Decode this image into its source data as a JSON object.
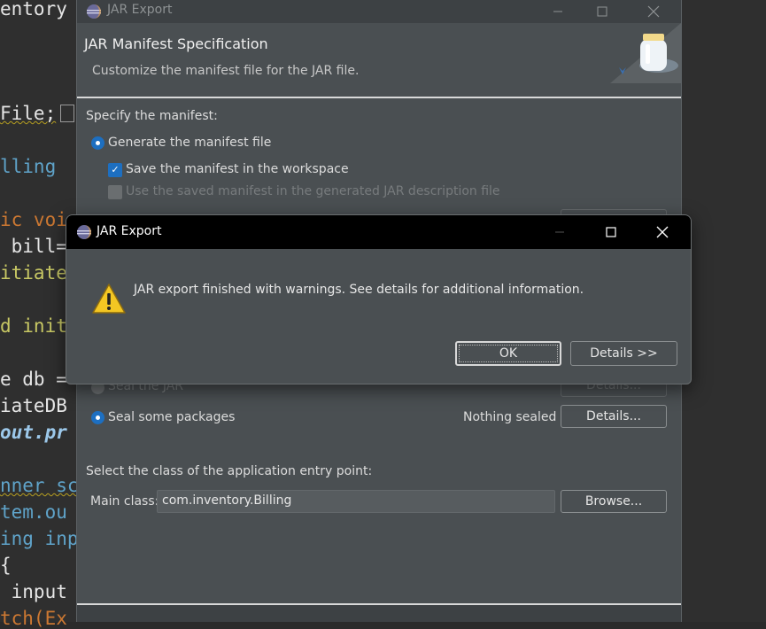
{
  "editor": {
    "lines": [
      {
        "text": "entory",
        "color": "#e6e6e6"
      },
      {
        "text": "File;",
        "color": "#e6e6e6"
      },
      {
        "text": "lling",
        "color": "#5fa3c9"
      },
      {
        "text": "ic voi",
        "color": "#cc7832"
      },
      {
        "text": " bill=",
        "color": "#e6e6e6"
      },
      {
        "text": "itiate",
        "color": "#c8c864"
      },
      {
        "text": "d init",
        "color": "#c8c864"
      },
      {
        "text": "e db =",
        "color": "#e6e6e6"
      },
      {
        "text": "iateDB",
        "color": "#e6e6e6"
      },
      {
        "text": "out.pr",
        "color": "#9cc8ea"
      },
      {
        "text": "nner sc",
        "color": "#5fa3c9"
      },
      {
        "text": "tem.ou",
        "color": "#5fa3c9"
      },
      {
        "text": "ing inp",
        "color": "#5fa3c9"
      },
      {
        "text": "{",
        "color": "#e6e6e6"
      },
      {
        "text": " input",
        "color": "#e6e6e6"
      },
      {
        "text": "tch(Ex",
        "color": "#cc7832"
      }
    ]
  },
  "wizard": {
    "window_title": "JAR Export",
    "header_title": "JAR Manifest Specification",
    "header_subtitle": "Customize the manifest file for the JAR file.",
    "specify_label": "Specify the manifest:",
    "generate_option": "Generate the manifest file",
    "save_checkbox": "Save the manifest in the workspace",
    "use_saved_checkbox": "Use the saved manifest in the generated JAR description file",
    "seal_jar_option": "Seal the JAR",
    "seal_jar_details": "Details...",
    "seal_some_option": "Seal some packages",
    "nothing_sealed": "Nothing sealed",
    "seal_some_details": "Details...",
    "entry_point_label": "Select the class of the application entry point:",
    "main_class_label": "Main class:",
    "main_class_value": "com.inventory.Billing",
    "browse_button": "Browse..."
  },
  "dialog": {
    "title": "JAR Export",
    "message": "JAR export finished with warnings. See details for additional information.",
    "ok_button": "OK",
    "details_button": "Details >>"
  },
  "icons": {
    "app": "eclipse-icon",
    "warning": "warning-icon",
    "banner": "jar-icon"
  },
  "colors": {
    "accent": "#1d6fc1",
    "warning": "#f3c623"
  }
}
